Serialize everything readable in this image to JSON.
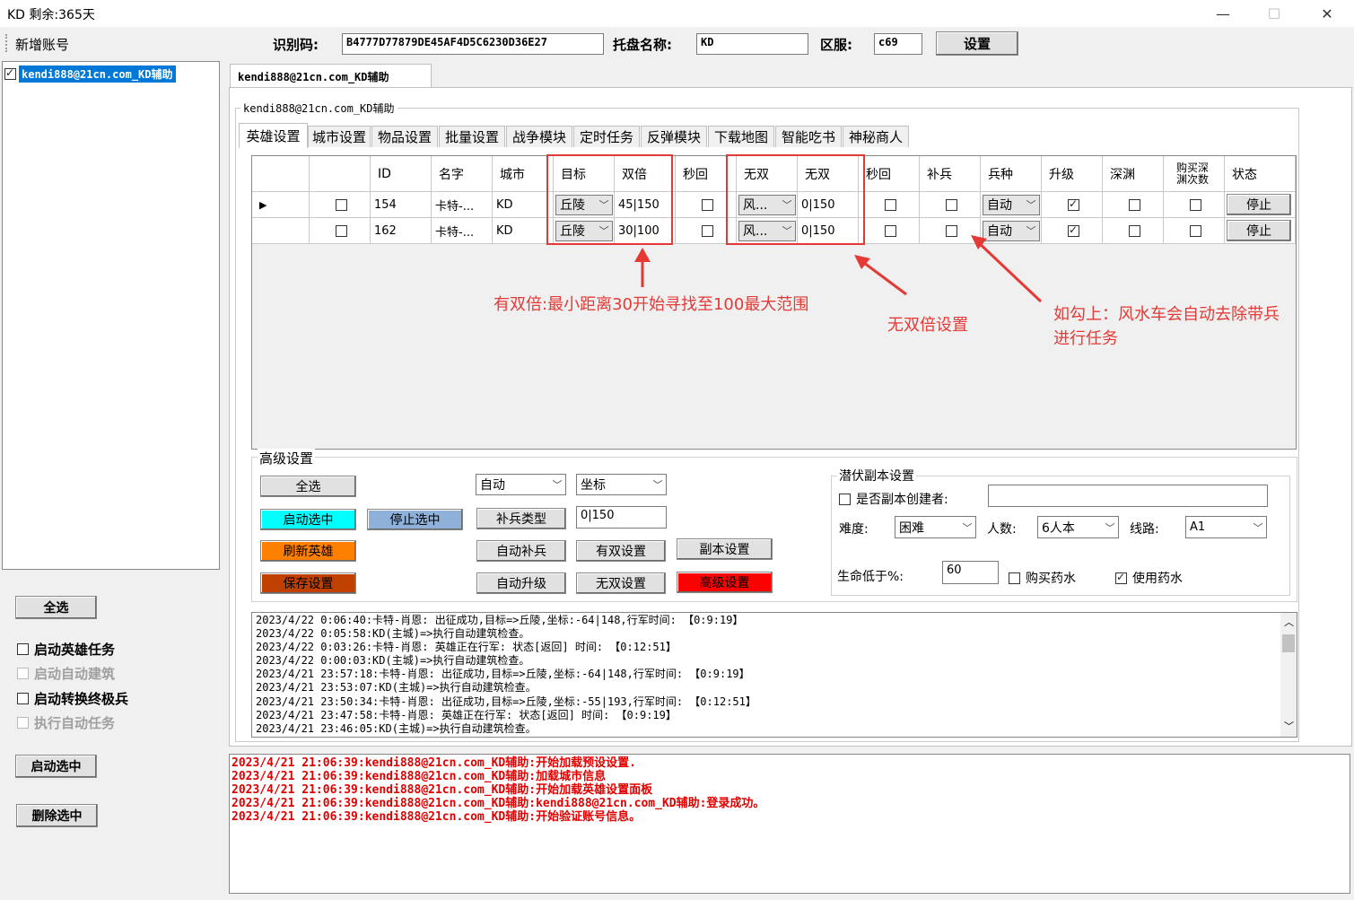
{
  "titlebar": {
    "title": "KD 剩余:365天",
    "minimize": "—",
    "maximize": "☐",
    "close": "✕"
  },
  "toolbar": {
    "new_account": "新增账号",
    "id_code_label": "识别码:",
    "id_code_value": "B4777D77879DE45AF4D5C6230D36E27",
    "host_name_label": "托盘名称:",
    "host_name_value": "KD",
    "server_label": "区服:",
    "server_value": "c69",
    "settings_button": "设置"
  },
  "account_list": [
    {
      "label": "kendi888@21cn.com_KD辅助",
      "checked": true
    }
  ],
  "account_tab": "kendi888@21cn.com_KD辅助",
  "group_title": "kendi888@21cn.com_KD辅助",
  "tabs": [
    "英雄设置",
    "城市设置",
    "物品设置",
    "批量设置",
    "战争模块",
    "定时任务",
    "反弹模块",
    "下载地图",
    "智能吃书",
    "神秘商人"
  ],
  "grid": {
    "columns": [
      "",
      "ID",
      "名字",
      "城市",
      "目标",
      "双倍",
      "秒回",
      "无双",
      "无双",
      "秒回",
      "补兵",
      "兵种",
      "升级",
      "深渊",
      "购买深渊次数",
      "状态"
    ],
    "rows": [
      {
        "marker": "▶",
        "checked": false,
        "id": "154",
        "name": "卡特-...",
        "city": "KD",
        "target": "丘陵",
        "double": "45|150",
        "sec_back": false,
        "wushuang_select": "风...",
        "wushuang": "0|150",
        "sec_back2": false,
        "reinforce": false,
        "troop": "自动",
        "upgrade": true,
        "abyss": false,
        "buy_abyss": false,
        "status": "停止"
      },
      {
        "marker": "",
        "checked": false,
        "id": "162",
        "name": "卡特-...",
        "city": "KD",
        "target": "丘陵",
        "double": "30|100",
        "sec_back": false,
        "wushuang_select": "风...",
        "wushuang": "0|150",
        "sec_back2": false,
        "reinforce": false,
        "troop": "自动",
        "upgrade": true,
        "abyss": false,
        "buy_abyss": false,
        "status": "停止"
      }
    ]
  },
  "annotations": {
    "double": "有双倍:最小距离30开始寻找至100最大范围",
    "wushuang": "无双倍设置",
    "reinforce_line1": "如勾上：风水车会自动去除带兵",
    "reinforce_line2": "进行任务",
    "color": "#e53935"
  },
  "advanced": {
    "title": "高级设置",
    "select_all": "全选",
    "start_selected": "启动选中",
    "stop_selected": "停止选中",
    "refresh_heroes": "刷新英雄",
    "save_settings": "保存设置",
    "mode_select": "自动",
    "coord_select": "坐标",
    "reinforce_type": "补兵类型",
    "range_value": "0|150",
    "auto_reinforce": "自动补兵",
    "double_settings": "有双设置",
    "dungeon_settings": "副本设置",
    "auto_upgrade": "自动升级",
    "wushuang_settings": "无双设置",
    "advanced_settings": "高级设置",
    "colors": {
      "cyan": "#00ffff",
      "steel": "#8fb0d8",
      "orange": "#ff8000",
      "brown": "#c04000",
      "red": "#ff0000"
    }
  },
  "ambush": {
    "title": "潜伏副本设置",
    "creator_label": "是否副本创建者:",
    "creator_checked": false,
    "creator_value": "",
    "difficulty_label": "难度:",
    "difficulty_value": "困难",
    "people_label": "人数:",
    "people_value": "6人本",
    "route_label": "线路:",
    "route_value": "A1",
    "hp_label": "生命低于%:",
    "hp_value": "60",
    "buy_potion": "购买药水",
    "buy_potion_checked": false,
    "use_potion": "使用药水",
    "use_potion_checked": true
  },
  "hero_log": [
    "2023/4/22 0:06:40:卡特-肖恩: 出征成功,目标=>丘陵,坐标:-64|148,行军时间: 【0:9:19】",
    "2023/4/22 0:05:58:KD(主城)=>执行自动建筑检查。",
    "2023/4/22 0:03:26:卡特-肖恩: 英雄正在行军: 状态[返回] 时间: 【0:12:51】",
    "2023/4/22 0:00:03:KD(主城)=>执行自动建筑检查。",
    "2023/4/21 23:57:18:卡特-肖恩: 出征成功,目标=>丘陵,坐标:-64|148,行军时间: 【0:9:19】",
    "2023/4/21 23:53:07:KD(主城)=>执行自动建筑检查。",
    "2023/4/21 23:50:34:卡特-肖恩: 出征成功,目标=>丘陵,坐标:-55|193,行军时间: 【0:12:51】",
    "2023/4/21 23:47:58:卡特-肖恩: 英雄正在行军: 状态[返回] 时间: 【0:9:19】",
    "2023/4/21 23:46:05:KD(主城)=>执行自动建筑检查。"
  ],
  "left_panel": {
    "select_all": "全选",
    "start_hero_task": "启动英雄任务",
    "start_auto_build": "启动自动建筑",
    "start_convert": "启动转换终极兵",
    "run_auto_task": "执行自动任务",
    "start_selected": "启动选中",
    "delete_selected": "删除选中"
  },
  "system_log": [
    "2023/4/21 21:06:39:kendi888@21cn.com_KD辅助:开始加载预设设置.",
    "2023/4/21 21:06:39:kendi888@21cn.com_KD辅助:加载城市信息",
    "2023/4/21 21:06:39:kendi888@21cn.com_KD辅助:开始加载英雄设置面板",
    "2023/4/21 21:06:39:kendi888@21cn.com_KD辅助:kendi888@21cn.com_KD辅助:登录成功。",
    "2023/4/21 21:06:39:kendi888@21cn.com_KD辅助:开始验证账号信息。"
  ],
  "system_log_color": "#e00000"
}
